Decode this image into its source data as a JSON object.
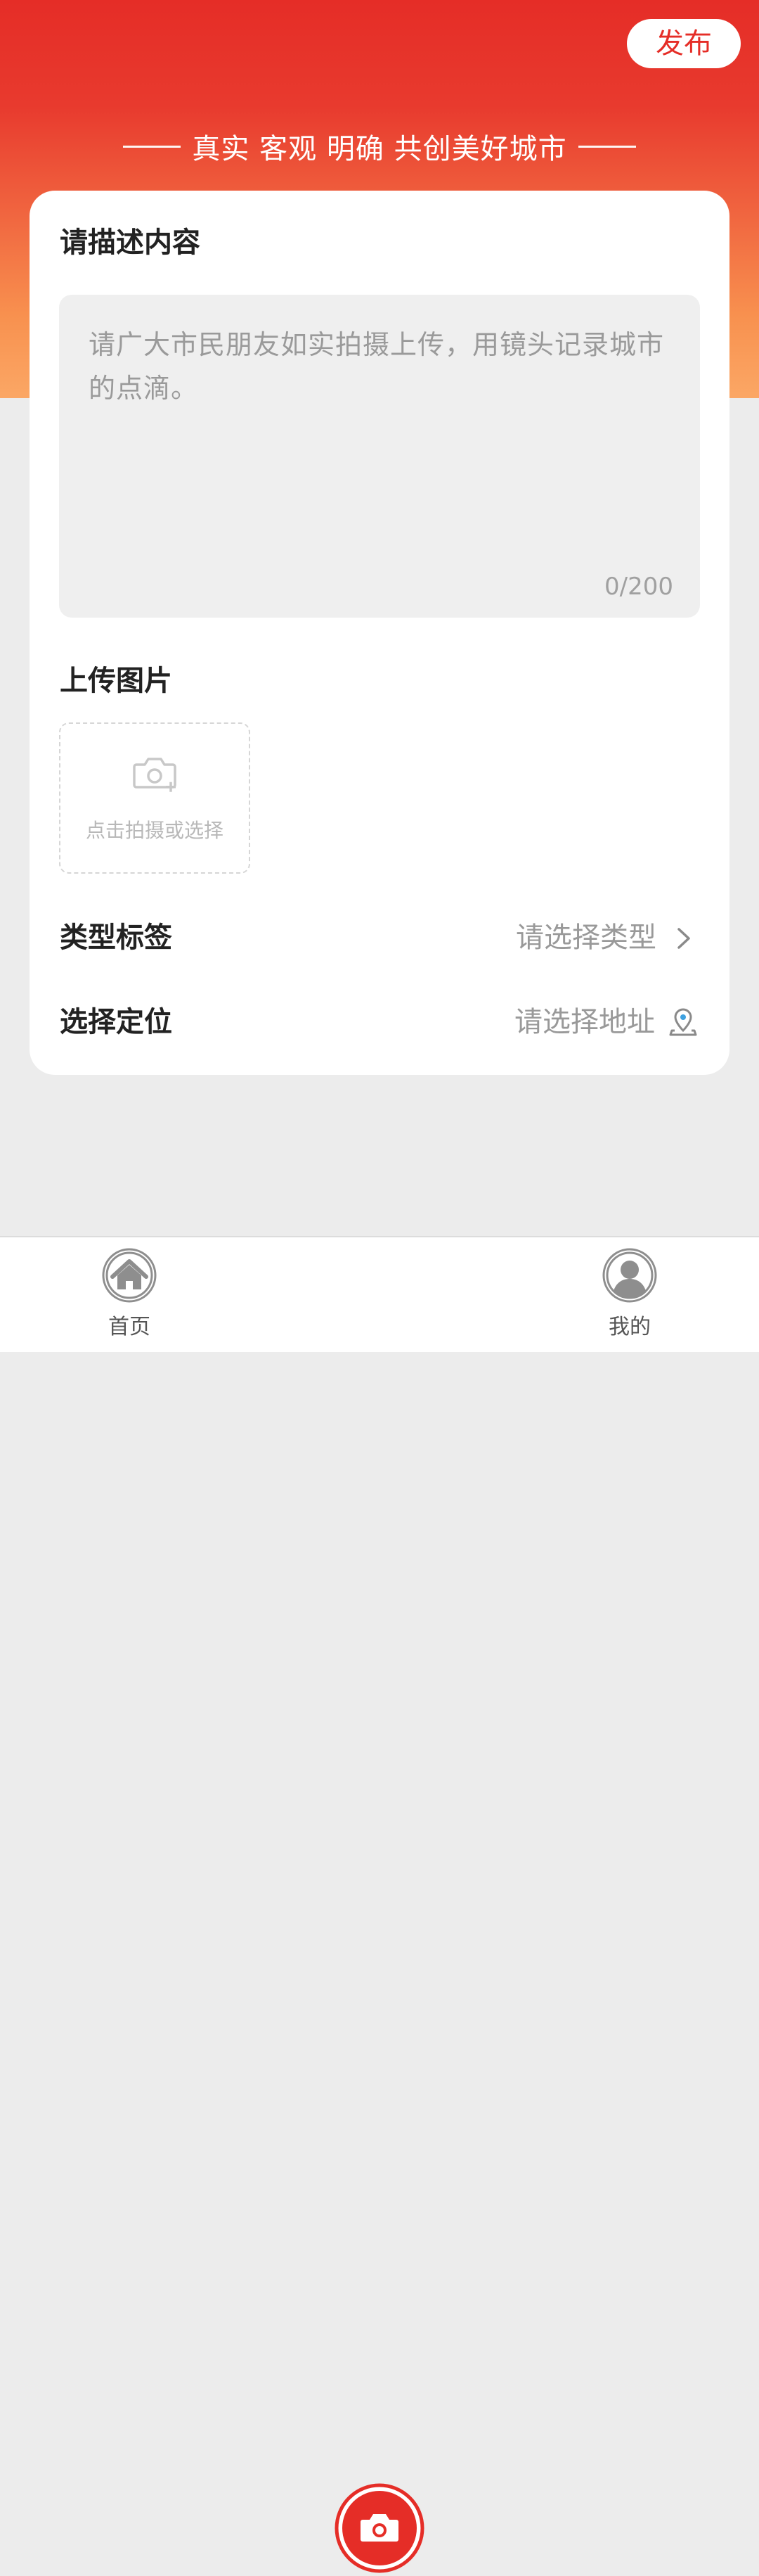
{
  "header": {
    "publish_label": "发布",
    "slogan": "真实 客观 明确 共创美好城市"
  },
  "form": {
    "description": {
      "label": "请描述内容",
      "placeholder": "请广大市民朋友如实拍摄上传，用镜头记录城市的点滴。",
      "counter": "0/200"
    },
    "upload": {
      "label": "上传图片",
      "hint": "点击拍摄或选择"
    },
    "type": {
      "label": "类型标签",
      "value": "请选择类型"
    },
    "location": {
      "label": "选择定位",
      "value": "请选择地址"
    }
  },
  "tabbar": {
    "items": [
      {
        "label": "首页",
        "icon": "home-icon"
      },
      {
        "label": "",
        "icon": "camera-icon"
      },
      {
        "label": "我的",
        "icon": "user-icon"
      }
    ]
  },
  "colors": {
    "accent": "#e52d27",
    "hero_top": "#e52d27",
    "hero_bottom": "#fba765",
    "background": "#ececec"
  }
}
